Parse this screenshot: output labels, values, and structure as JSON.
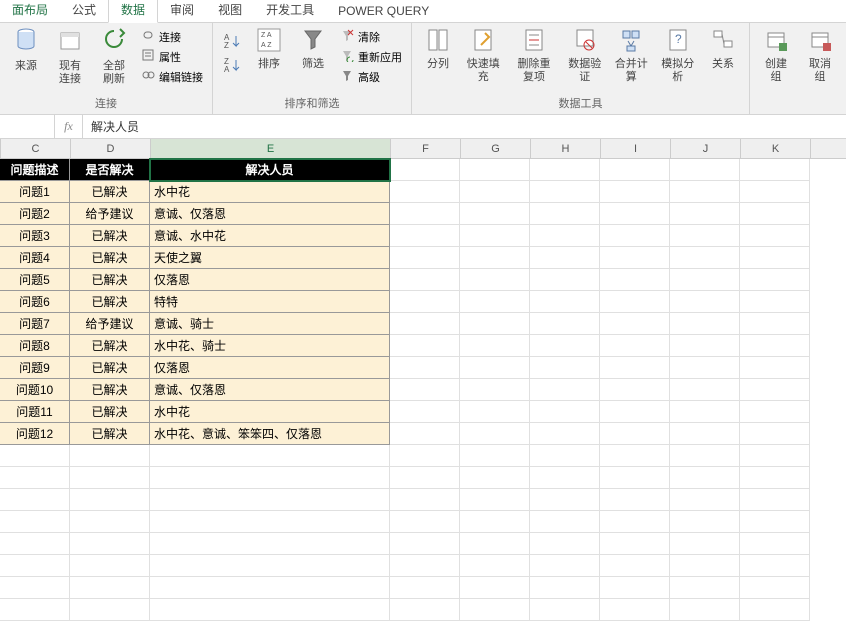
{
  "tabs": {
    "layout": "面布局",
    "formulas": "公式",
    "data": "数据",
    "review": "审阅",
    "view": "视图",
    "developer": "开发工具",
    "powerquery": "POWER QUERY"
  },
  "ribbon": {
    "source": "来源",
    "existing": "现有连接",
    "refresh": "全部刷新",
    "conns": "连接",
    "props": "属性",
    "editlinks": "编辑链接",
    "sort": "排序",
    "filter": "筛选",
    "clear": "清除",
    "reapply": "重新应用",
    "advanced": "高级",
    "texttocol": "分列",
    "flashfill": "快速填充",
    "removedup": "删除重复项",
    "datavalid": "数据验证",
    "consolidate": "合并计算",
    "whatif": "模拟分析",
    "relations": "关系",
    "groupcreate": "创建组",
    "ungroup": "取消组",
    "groups": {
      "conn": "连接",
      "sortfilter": "排序和筛选",
      "datatools": "数据工具"
    }
  },
  "formula": {
    "fx": "fx",
    "value": "解决人员"
  },
  "cols": {
    "C": "C",
    "D": "D",
    "E": "E",
    "F": "F",
    "G": "G",
    "H": "H",
    "I": "I",
    "J": "J",
    "K": "K"
  },
  "headers": {
    "c": "问题描述",
    "d": "是否解决",
    "e": "解决人员"
  },
  "rows": [
    {
      "c": "问题1",
      "d": "已解决",
      "e": "水中花"
    },
    {
      "c": "问题2",
      "d": "给予建议",
      "e": "意诚、仅落恩"
    },
    {
      "c": "问题3",
      "d": "已解决",
      "e": "意诚、水中花"
    },
    {
      "c": "问题4",
      "d": "已解决",
      "e": "天使之翼"
    },
    {
      "c": "问题5",
      "d": "已解决",
      "e": "仅落恩"
    },
    {
      "c": "问题6",
      "d": "已解决",
      "e": "特特"
    },
    {
      "c": "问题7",
      "d": "给予建议",
      "e": "意诚、骑士"
    },
    {
      "c": "问题8",
      "d": "已解决",
      "e": "水中花、骑士"
    },
    {
      "c": "问题9",
      "d": "已解决",
      "e": "仅落恩"
    },
    {
      "c": "问题10",
      "d": "已解决",
      "e": "意诚、仅落恩"
    },
    {
      "c": "问题11",
      "d": "已解决",
      "e": "水中花"
    },
    {
      "c": "问题12",
      "d": "已解决",
      "e": "水中花、意诚、笨笨四、仅落恩"
    }
  ]
}
